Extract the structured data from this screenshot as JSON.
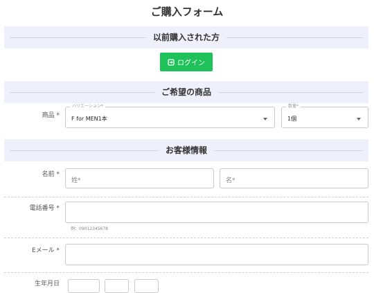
{
  "page": {
    "title": "ご購入フォーム"
  },
  "sections": {
    "previous": "以前購入された方",
    "product": "ご希望の商品",
    "customer": "お客様情報"
  },
  "login": {
    "label": "ログイン",
    "icon": "login-icon",
    "color": "#1fc15a"
  },
  "product": {
    "label": "商品",
    "required_mark": "*",
    "variation": {
      "legend": "バリエーション*",
      "value": "F for MEN1本"
    },
    "quantity": {
      "legend": "数量*",
      "value": "1個"
    }
  },
  "customer": {
    "name": {
      "label": "名前",
      "required_mark": "*",
      "last_placeholder": "姓*",
      "first_placeholder": "名*"
    },
    "phone": {
      "label": "電話番号",
      "required_mark": "*",
      "hint": "例：09012345678"
    },
    "email": {
      "label": "Eメール",
      "required_mark": "*"
    },
    "birthday": {
      "label": "生年月日"
    }
  }
}
